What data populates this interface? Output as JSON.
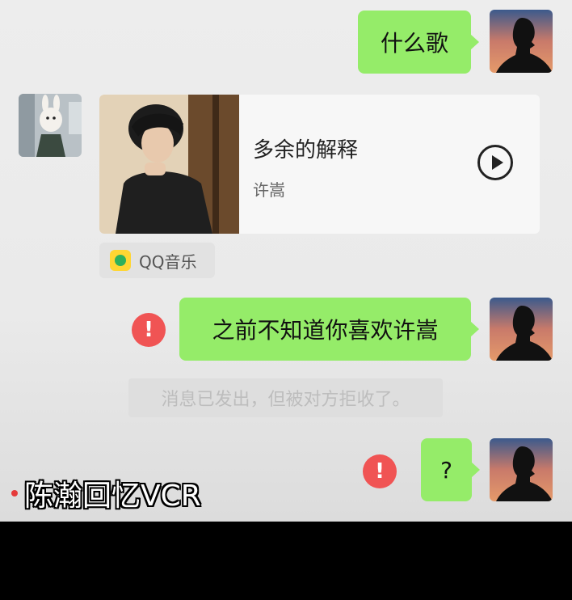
{
  "messages": {
    "m1": {
      "text": "什么歌"
    },
    "music_card": {
      "title": "多余的解释",
      "artist": "许嵩",
      "source": "QQ音乐"
    },
    "m2": {
      "text": "之前不知道你喜欢许嵩",
      "error_mark": "!"
    },
    "system_note": "消息已发出，但被对方拒收了。",
    "m3": {
      "text": "?",
      "error_mark": "!"
    }
  },
  "overlay": {
    "caption": "陈瀚回忆VCR"
  },
  "colors": {
    "sent_bubble": "#95ec69",
    "error": "#f05454",
    "caption_dot": "#e53b3b"
  },
  "icons": {
    "play": "play-icon",
    "error": "exclamation-icon",
    "source": "qq-music-icon"
  }
}
